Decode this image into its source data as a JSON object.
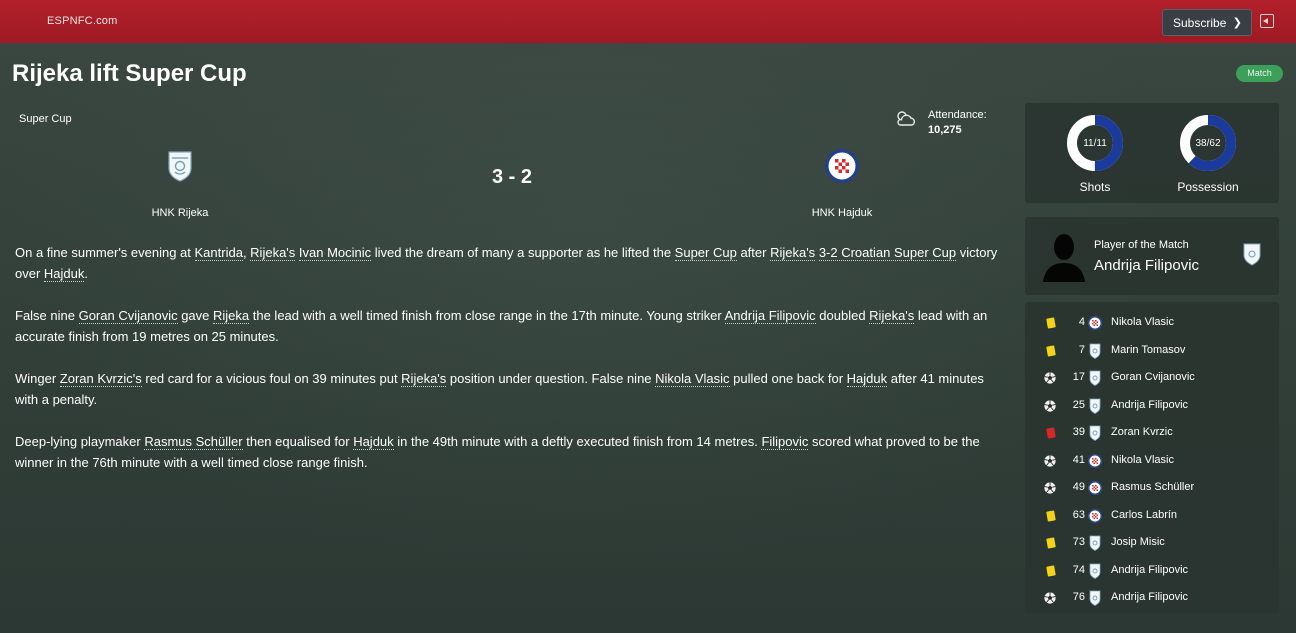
{
  "topbar": {
    "brand": "ESPNFC.com",
    "subscribe_label": "Subscribe"
  },
  "header": {
    "title": "Rijeka lift Super Cup",
    "badge": "Match"
  },
  "match": {
    "competition": "Super Cup",
    "attendance_label": "Attendance:",
    "attendance_value": "10,275",
    "score": "3 - 2",
    "home_team": "HNK Rijeka",
    "away_team": "HNK Hajduk"
  },
  "report": {
    "p1": {
      "s1": "On a fine summer's evening at ",
      "l1": "Kantrida",
      "s2": ", ",
      "l2": "Rijeka's",
      "s3": " ",
      "l3": "Ivan Mocinic",
      "s4": " lived the dream of many a supporter as he lifted the ",
      "l4": "Super Cup",
      "s5": " after ",
      "l5": "Rijeka's",
      "s6": " ",
      "l6": "3-2 Croatian Super Cup",
      "s7": " victory over ",
      "l7": "Hajduk",
      "s8": "."
    },
    "p2": {
      "s1": "False nine ",
      "l1": "Goran Cvijanovic",
      "s2": " gave ",
      "l2": "Rijeka",
      "s3": " the lead with a well timed finish from close range in the 17th minute. Young striker ",
      "l3": "Andrija Filipovic",
      "s4": " doubled ",
      "l4": "Rijeka's",
      "s5": " lead with an accurate finish from 19 metres on 25 minutes."
    },
    "p3": {
      "s1": "Winger ",
      "l1": "Zoran Kvrzic's",
      "s2": " red card for a vicious foul on 39 minutes put ",
      "l2": "Rijeka's",
      "s3": " position under question. False nine ",
      "l3": "Nikola Vlasic",
      "s4": " pulled one back for ",
      "l4": "Hajduk",
      "s5": " after 41 minutes with a penalty."
    },
    "p4": {
      "s1": "Deep-lying playmaker ",
      "l1": "Rasmus Schüller",
      "s2": " then equalised for ",
      "l2": "Hajduk",
      "s3": " in the 49th minute with a deftly executed finish from 14 metres. ",
      "l3": "Filipovic",
      "s4": " scored what proved to be the winner in the 76th minute with a well timed close range finish."
    }
  },
  "stats": {
    "shots": {
      "value": "11/11",
      "label": "Shots",
      "home": 11,
      "away": 11
    },
    "possession": {
      "value": "38/62",
      "label": "Possession",
      "home": 38,
      "away": 62
    },
    "colors": {
      "home": "#ffffff",
      "away": "#1a3a9c"
    }
  },
  "potm": {
    "label": "Player of the Match",
    "name": "Andrija Filipovic"
  },
  "events": [
    {
      "type": "yellow-card",
      "minute": "4",
      "team": "away",
      "player": "Nikola Vlasic"
    },
    {
      "type": "yellow-card",
      "minute": "7",
      "team": "home",
      "player": "Marin Tomasov"
    },
    {
      "type": "goal",
      "minute": "17",
      "team": "home",
      "player": "Goran Cvijanovic"
    },
    {
      "type": "goal",
      "minute": "25",
      "team": "home",
      "player": "Andrija Filipovic"
    },
    {
      "type": "red-card",
      "minute": "39",
      "team": "home",
      "player": "Zoran Kvrzic"
    },
    {
      "type": "goal",
      "minute": "41",
      "team": "away",
      "player": "Nikola Vlasic"
    },
    {
      "type": "goal",
      "minute": "49",
      "team": "away",
      "player": "Rasmus Schüller"
    },
    {
      "type": "yellow-card",
      "minute": "63",
      "team": "away",
      "player": "Carlos Labrín"
    },
    {
      "type": "yellow-card",
      "minute": "73",
      "team": "home",
      "player": "Josip Misic"
    },
    {
      "type": "yellow-card",
      "minute": "74",
      "team": "home",
      "player": "Andrija Filipovic"
    },
    {
      "type": "goal",
      "minute": "76",
      "team": "home",
      "player": "Andrija Filipovic"
    }
  ]
}
